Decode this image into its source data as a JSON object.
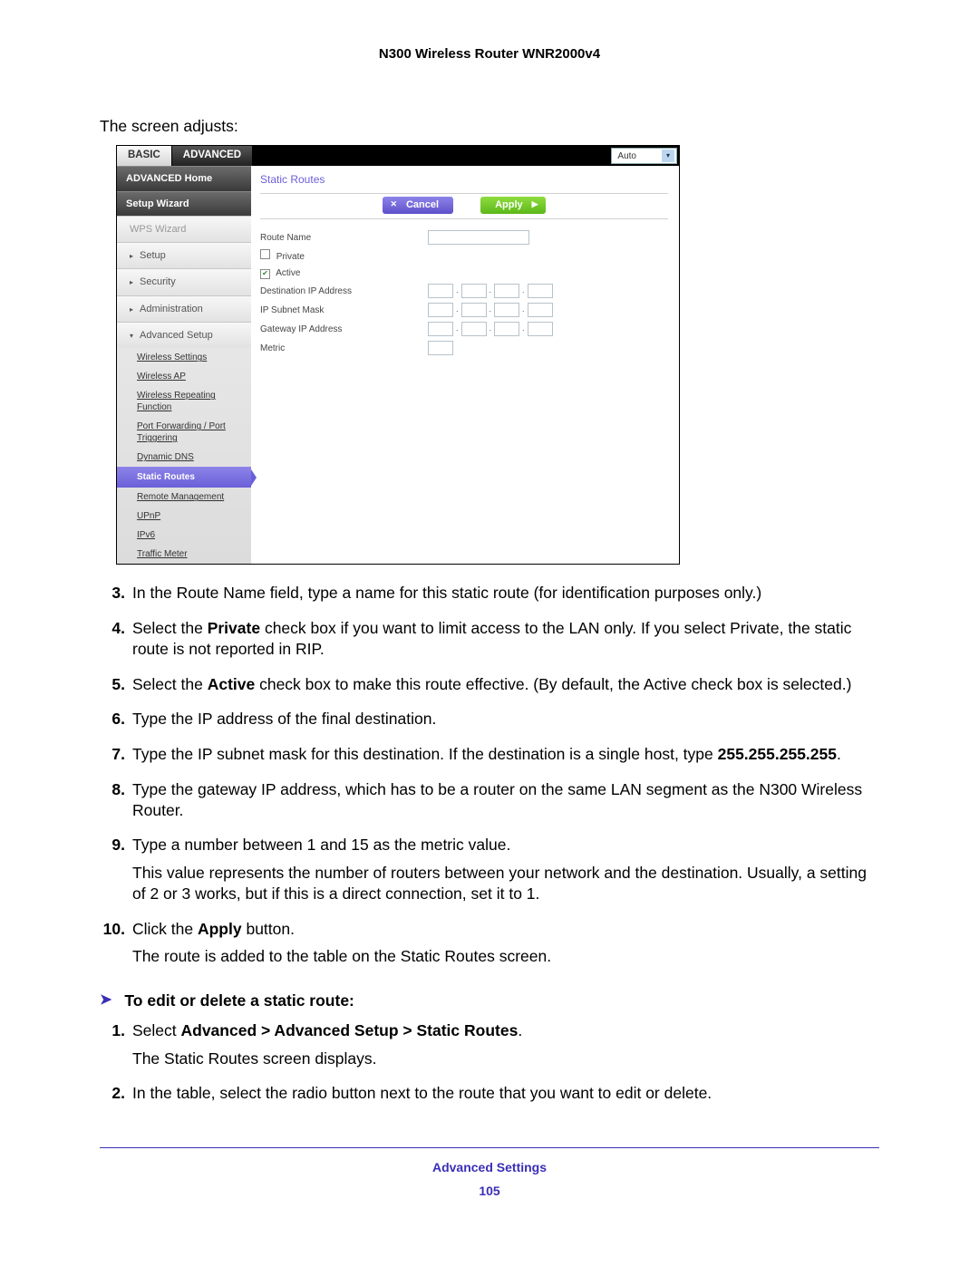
{
  "doc_title": "N300 Wireless Router WNR2000v4",
  "intro": "The screen adjusts:",
  "router": {
    "tabs": {
      "basic": "BASIC",
      "advanced": "ADVANCED"
    },
    "auto_label": "Auto",
    "side": {
      "adv_home": "ADVANCED Home",
      "setup_wizard": "Setup Wizard",
      "wps_wizard": "WPS Wizard",
      "setup": "Setup",
      "security": "Security",
      "administration": "Administration",
      "adv_setup": "Advanced Setup",
      "subs": {
        "wireless_settings": "Wireless Settings",
        "wireless_ap": "Wireless AP",
        "wireless_repeating": "Wireless Repeating Function",
        "port_fwd": "Port Forwarding / Port Triggering",
        "dynamic_dns": "Dynamic DNS",
        "static_routes": "Static Routes",
        "remote_mgmt": "Remote Management",
        "upnp": "UPnP",
        "ipv6": "IPv6",
        "traffic_meter": "Traffic Meter"
      }
    },
    "panel": {
      "title": "Static Routes",
      "cancel": "Cancel",
      "apply": "Apply",
      "route_name": "Route Name",
      "private": "Private",
      "active": "Active",
      "dest_ip": "Destination IP Address",
      "subnet": "IP Subnet Mask",
      "gateway": "Gateway IP Address",
      "metric": "Metric"
    }
  },
  "steps_a": [
    {
      "n": "3.",
      "parts": [
        "In the Route Name field, type a name for this static route (for identification purposes only.)"
      ]
    },
    {
      "n": "4.",
      "parts": [
        "Select the ",
        "Private",
        " check box if you want to limit access to the LAN only. If you select Private, the static route is not reported in RIP."
      ]
    },
    {
      "n": "5.",
      "parts": [
        "Select the ",
        "Active",
        " check box to make this route effective. (By default, the Active check box is selected.)"
      ]
    },
    {
      "n": "6.",
      "parts": [
        "Type the IP address of the final destination."
      ]
    },
    {
      "n": "7.",
      "parts": [
        "Type the IP subnet mask for this destination. If the destination is a single host, type ",
        "255.255.255.255",
        "."
      ]
    },
    {
      "n": "8.",
      "parts": [
        "Type the gateway IP address, which has to be a router on the same LAN segment as the N300 Wireless Router."
      ]
    },
    {
      "n": "9.",
      "parts": [
        "Type a number between 1 and 15 as the metric value."
      ],
      "extra": "This value represents the number of routers between your network and the destination. Usually, a setting of 2 or 3 works, but if this is a direct connection, set it to 1."
    },
    {
      "n": "10.",
      "parts": [
        "Click the ",
        "Apply",
        " button."
      ],
      "extra": "The route is added to the table on the Static Routes screen."
    }
  ],
  "proc_head": "To edit or delete a static route:",
  "steps_b": [
    {
      "n": "1.",
      "parts": [
        "Select ",
        "Advanced > Advanced Setup > Static Routes",
        "."
      ],
      "extra": "The Static Routes screen displays."
    },
    {
      "n": "2.",
      "parts": [
        "In the table, select the radio button next to the route that you want to edit or delete."
      ]
    }
  ],
  "footer": {
    "section": "Advanced Settings",
    "page": "105"
  }
}
